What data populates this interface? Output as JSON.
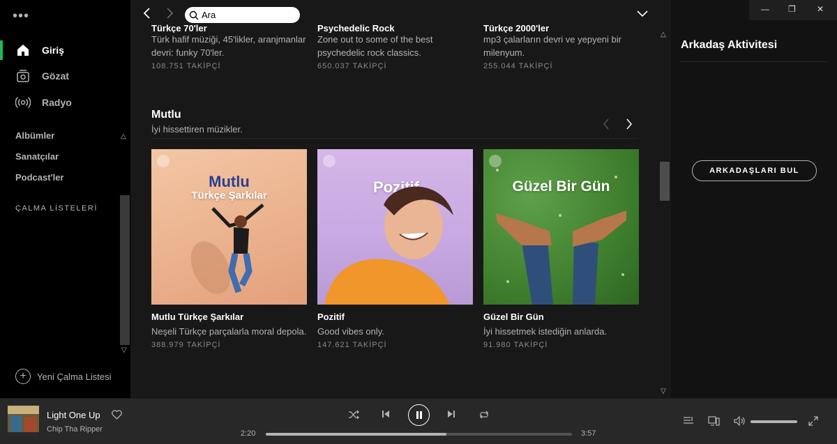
{
  "sidebar": {
    "menu_dots": "•••",
    "nav": [
      {
        "label": "Giriş",
        "icon": "home-icon"
      },
      {
        "label": "Gözat",
        "icon": "browse-icon"
      },
      {
        "label": "Radyo",
        "icon": "radio-icon"
      }
    ],
    "library": [
      "Albümler",
      "Sanatçılar",
      "Podcast'ler"
    ],
    "playlists_heading": "ÇALMA LİSTELERİ",
    "new_playlist": "Yeni Çalma Listesi"
  },
  "topbar": {
    "search_value": "Ara"
  },
  "previous_row": [
    {
      "title": "Türkçe 70'ler",
      "desc": "Türk hafif müziği, 45'likler, aranjmanlar devri: funky 70'ler.",
      "followers": "108.751 TAKİPÇİ"
    },
    {
      "title": "Psychedelic Rock",
      "desc": "Zone out to some of the best psychedelic rock classics.",
      "followers": "650.037 TAKİPÇİ"
    },
    {
      "title": "Türkçe 2000'ler",
      "desc": "mp3 çalarların devri ve yepyeni bir milenyum.",
      "followers": "255.044 TAKİPÇİ"
    }
  ],
  "section": {
    "title": "Mutlu",
    "subtitle": "İyi hissettiren müzikler.",
    "cards": [
      {
        "cover_title": "Mutlu",
        "cover_sub": "Türkçe Şarkılar",
        "name": "Mutlu Türkçe Şarkılar",
        "desc": "Neşeli Türkçe parçalarla moral depola.",
        "followers": "388.979 TAKİPÇİ"
      },
      {
        "cover_title": "Pozitif",
        "cover_sub": "",
        "name": "Pozitif",
        "desc": "Good vibes only.",
        "followers": "147.621 TAKİPÇİ"
      },
      {
        "cover_title": "Güzel Bir Gün",
        "cover_sub": "",
        "name": "Güzel Bir Gün",
        "desc": "İyi hissetmek istediğin anlarda.",
        "followers": "91.980 TAKİPÇİ"
      }
    ]
  },
  "friends": {
    "title": "Arkadaş Aktivitesi",
    "button": "ARKADAŞLARI BUL"
  },
  "player": {
    "track": "Light One Up",
    "artist": "Chip Tha Ripper",
    "elapsed": "2:20",
    "duration": "3:57",
    "progress": 0.59,
    "volume": 1.0
  },
  "colors": {
    "accent": "#1db954"
  }
}
